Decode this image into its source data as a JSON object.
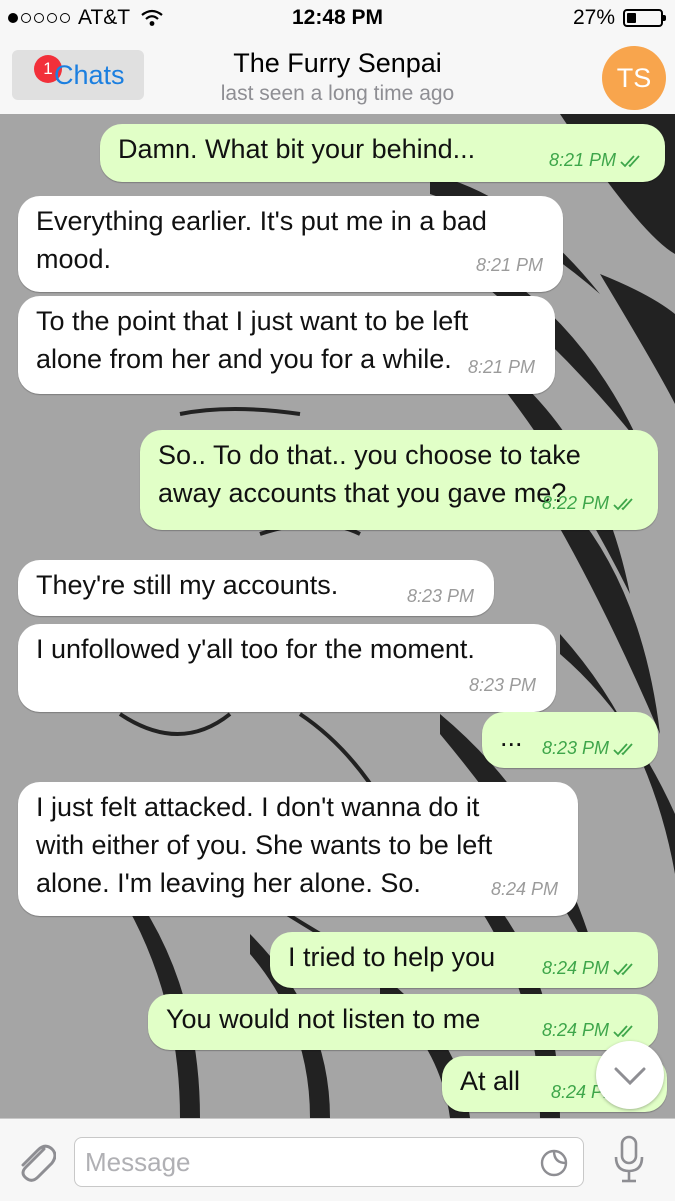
{
  "status_bar": {
    "carrier": "AT&T",
    "time": "12:48 PM",
    "battery": "27%",
    "battery_level": 0.27,
    "signal_bars": 1
  },
  "header": {
    "back_label": "Chats",
    "unread_badge": "1",
    "title": "The Furry Senpai",
    "subtitle": "last seen a long time ago",
    "avatar_initials": "TS",
    "avatar_color": "#f8a54d",
    "accent_color": "#1b7fe0"
  },
  "messages": [
    {
      "dir": "out",
      "lines": [
        "Damn. What bit your behind..."
      ],
      "time": "8:21 PM"
    },
    {
      "dir": "in",
      "lines": [
        "Everything earlier. It's put me in a bad",
        "mood."
      ],
      "time": "8:21 PM"
    },
    {
      "dir": "in",
      "lines": [
        "To the point that I just want to be left",
        "alone from her and you for a while."
      ],
      "time": "8:21 PM"
    },
    {
      "dir": "out",
      "lines": [
        "So.. To do that.. you choose to take",
        "away accounts that you gave me?"
      ],
      "time": "8:22 PM"
    },
    {
      "dir": "in",
      "lines": [
        "They're still my accounts."
      ],
      "time": "8:23 PM"
    },
    {
      "dir": "in",
      "lines": [
        "I unfollowed y'all too for the moment."
      ],
      "time": "8:23 PM"
    },
    {
      "dir": "out",
      "lines": [
        "..."
      ],
      "time": "8:23 PM"
    },
    {
      "dir": "in",
      "lines": [
        "I just felt attacked. I don't wanna do it",
        "with either of you. She wants to be left",
        "alone. I'm leaving her alone. So."
      ],
      "time": "8:24 PM"
    },
    {
      "dir": "out",
      "lines": [
        "I tried to help you"
      ],
      "time": "8:24 PM"
    },
    {
      "dir": "out",
      "lines": [
        "You would not listen to me"
      ],
      "time": "8:24 PM"
    },
    {
      "dir": "out",
      "lines": [
        "At all"
      ],
      "time": "8:24 PM"
    }
  ],
  "input_bar": {
    "placeholder": "Message"
  },
  "colors": {
    "incoming_bubble": "#ffffff",
    "outgoing_bubble": "#e1ffc7",
    "outgoing_meta": "#3ea64a",
    "incoming_meta": "#9b9b9b",
    "badge": "#f2303a"
  },
  "icons": {
    "attach": "paperclip-icon",
    "sticker": "sticker-icon",
    "mic": "microphone-icon",
    "scroll_down": "chevron-down-icon",
    "wifi": "wifi-icon",
    "battery": "battery-icon",
    "read_receipt": "double-check-icon"
  }
}
